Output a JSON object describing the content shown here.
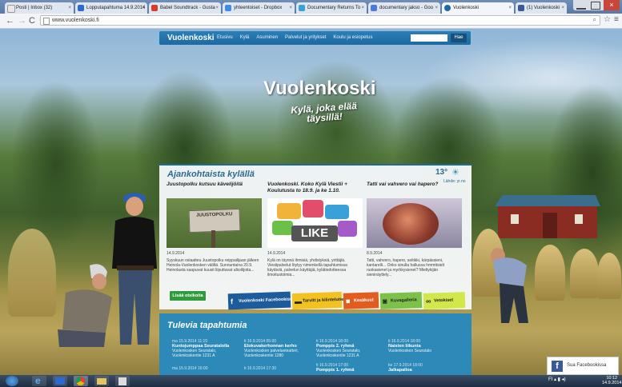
{
  "browser": {
    "tabs": [
      {
        "label": "Posti | Inbox (32)",
        "active": false
      },
      {
        "label": "Lopputapahtuma 14.9.2014",
        "active": false
      },
      {
        "label": "Babel Soundtrack - Gusta",
        "active": false
      },
      {
        "label": "yhteentoiset - Dropbox",
        "active": false
      },
      {
        "label": "Documentary Returns To",
        "active": false
      },
      {
        "label": "documentary jakso - Goo",
        "active": false
      },
      {
        "label": "Vuolenkoski",
        "active": true
      },
      {
        "label": "(1) Vuolenkoski",
        "active": false
      }
    ],
    "url": "www.vuolenkoski.fi"
  },
  "site": {
    "logo": "Vuolenkoski",
    "nav": [
      "Etusivu",
      "Kylä",
      "Asuminen",
      "Palvelut ja yritykset",
      "Koulu ja esiopetus"
    ],
    "search_button": "Hae",
    "hero_title": "Vuolenkoski",
    "hero_slogan": "Kylä, joka elää täysillä!"
  },
  "news": {
    "title": "Ajankohtaista kylällä",
    "weather": {
      "temp": "13°",
      "link": "Lähde: yr.no"
    },
    "articles": [
      {
        "title": "Juustopolku kutsuu kävelijöitä",
        "date": "14.9.2014",
        "text": "Syyskuun oslaatteu Juustopolku reippailijaan jälleen Heinola-Vuolenkosken väliltä. Sunnuntaina 20.9. Heinolasta saapuvat kuusit liiputtavat ulkoilijoita...",
        "sign": "JUUSTOPOLKU"
      },
      {
        "title": "Vuolenkoski. Koko Kylä Viestii + Koulutusta to 18.9. ja ke 1.10.",
        "date": "14.9.2014",
        "text": "Kylä on täynnä ihmisiä, yhdistyksiä, yrittäjiä. Viestipalvelut löytyy nimenkellä tapahtumissa käytäviä, palvelun käyttäjiä, kylätiedotteessa ilmoitustoimia...",
        "sign": "LIKE"
      },
      {
        "title": "Tatti vai vahvero vai hapero?",
        "date": "8.9.2014",
        "text": "Tatti, vahvero, hapero, seitikki, kärpässieni, kantarelli... Onko sinulla hallussa hmmttsielt ruokasienet ja myrkkysienet? Mieltykijän sieninäyttely...",
        "sign": ""
      }
    ],
    "more_button": "Lisää otsikoita",
    "social": [
      {
        "label": "Vuolenkoski Facebookissa",
        "icon": "facebook-icon"
      },
      {
        "label": "Tarvitt ja kilintelutie",
        "icon": "shopping-cart-icon"
      },
      {
        "label": "Kesäkuut",
        "icon": "bus-icon"
      },
      {
        "label": "Kuvagalleria",
        "icon": "camera-icon"
      },
      {
        "label": "Vetokiset",
        "icon": "bicycle-icon"
      }
    ]
  },
  "events": {
    "title": "Tulevia tapahtumia",
    "items": [
      {
        "date": "ma 15.9.2014 11:15",
        "title": "Kuntojumppaa Seuratalolla",
        "place": "Vuolenkosken Seuratalo, Vuolenkoskentie 1231 A"
      },
      {
        "date": "ti 16.9.2014 05:00",
        "title": "Elokuvakerhonnan kerho",
        "place": "Vuolenkosken palvelueteatteri, Vuolenkoskentie 1280"
      },
      {
        "date": "ti 16.9.2014 18:00",
        "title": "Pomppis 2. ryhmä",
        "place": "Vuolenkosken Seuratalo, Vuolenkoskentie 1231 A"
      },
      {
        "date": "ti 16.9.2014 18:00",
        "title": "Naisten liikunta",
        "place": "Vuolenkosken Seuratalo"
      },
      {
        "date": "ma 15.9.2014 16:00",
        "title": "",
        "place": ""
      },
      {
        "date": "ti 16.9.2014 17:30",
        "title": "",
        "place": ""
      },
      {
        "date": "ti 16.9.2014 17:00",
        "title": "Pomppis 1. ryhmä",
        "place": ""
      },
      {
        "date": "ke 17.9.2014 18:00",
        "title": "Jalkapalloa",
        "place": ""
      }
    ]
  },
  "facebook_widget": {
    "label": "Sua Facebookissa"
  },
  "taskbar": {
    "time": "10:12",
    "date": "14.9.2014"
  },
  "colors": {
    "nav_blue": "#1d6aa0",
    "events_blue": "#2c89b8",
    "green_button": "#2f9b3a"
  }
}
